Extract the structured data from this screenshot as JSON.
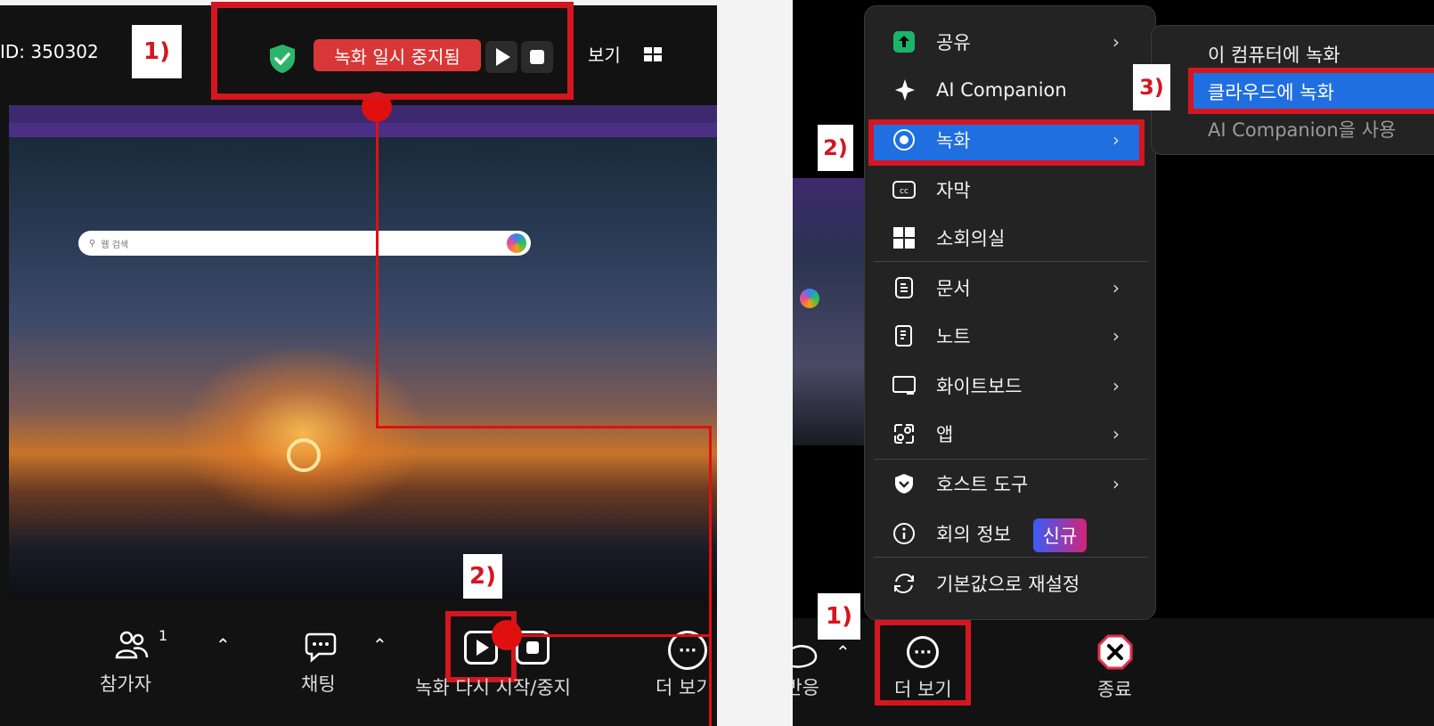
{
  "left": {
    "meeting_id": "ID: 350302",
    "step1": "1)",
    "rec_paused": "녹화 일시 중지됨",
    "view": "보기",
    "search_placeholder": "웹 검색",
    "step2": "2)",
    "toolbar": {
      "participants_label": "참가자",
      "participants_count": "1",
      "chat_label": "채팅",
      "record_label": "녹화 다시 시작/중지",
      "more_label": "더 보기"
    }
  },
  "right": {
    "menu_items": [
      {
        "label": "공유",
        "icon": "share-icon",
        "arrow": true
      },
      {
        "label": "AI Companion",
        "icon": "sparkle-icon",
        "arrow": false
      },
      {
        "label": "녹화",
        "icon": "record-icon",
        "arrow": true
      },
      {
        "label": "자막",
        "icon": "cc-icon",
        "arrow": false
      },
      {
        "label": "소회의실",
        "icon": "breakout-icon",
        "arrow": false
      },
      {
        "label": "문서",
        "icon": "docs-icon",
        "arrow": true
      },
      {
        "label": "노트",
        "icon": "notes-icon",
        "arrow": true
      },
      {
        "label": "화이트보드",
        "icon": "whiteboard-icon",
        "arrow": true
      },
      {
        "label": "앱",
        "icon": "apps-icon",
        "arrow": true
      },
      {
        "label": "호스트 도구",
        "icon": "host-tools-icon",
        "arrow": true
      },
      {
        "label": "회의 정보",
        "icon": "info-icon",
        "arrow": false
      },
      {
        "label": "기본값으로 재설정",
        "icon": "reset-icon",
        "arrow": false
      }
    ],
    "badge_new": "신규",
    "submenu": {
      "item1": "이 컴퓨터에 녹화",
      "item2": "클라우드에 녹화",
      "item3": "AI Companion을 사용"
    },
    "step1": "1)",
    "step2": "2)",
    "step3": "3)",
    "toolbar": {
      "more_label": "더 보기",
      "end_label": "종료",
      "partial_label": "반응"
    }
  },
  "colors": {
    "highlight_red": "#d41620",
    "menu_bg": "#232323",
    "selection_blue": "#1f6fe0",
    "paused_red": "#d83737"
  }
}
